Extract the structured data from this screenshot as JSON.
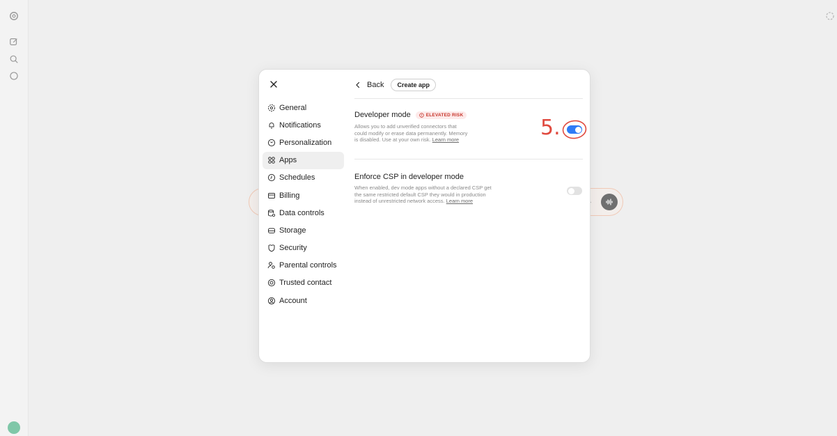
{
  "rail": {
    "icons": [
      "logo-icon",
      "new-chat-icon",
      "search-icon",
      "chat-icon"
    ]
  },
  "modal": {
    "nav": [
      {
        "label": "General",
        "icon": "gear-icon"
      },
      {
        "label": "Notifications",
        "icon": "bell-icon"
      },
      {
        "label": "Personalization",
        "icon": "personalization-icon"
      },
      {
        "label": "Apps",
        "icon": "apps-grid-icon",
        "active": true
      },
      {
        "label": "Schedules",
        "icon": "clock-icon"
      },
      {
        "label": "Billing",
        "icon": "card-icon"
      },
      {
        "label": "Data controls",
        "icon": "database-icon"
      },
      {
        "label": "Storage",
        "icon": "storage-icon"
      },
      {
        "label": "Security",
        "icon": "shield-icon"
      },
      {
        "label": "Parental controls",
        "icon": "parental-icon"
      },
      {
        "label": "Trusted contact",
        "icon": "lifebuoy-icon"
      },
      {
        "label": "Account",
        "icon": "account-icon"
      }
    ],
    "back_label": "Back",
    "create_app_label": "Create app",
    "developer_mode": {
      "title": "Developer mode",
      "badge": "ELEVATED RISK",
      "desc_lines": [
        "Allows you to add unverified connectors that",
        "could modify or erase data permanently. Memory",
        "is disabled. Use at your own risk. "
      ],
      "learn_more": "Learn more",
      "enabled": true
    },
    "enforce_csp": {
      "title": "Enforce CSP in developer mode",
      "desc_lines": [
        "When enabled, dev mode apps without a declared CSP get",
        "the same restricted default CSP they would in production",
        "instead of unrestricted network access. "
      ],
      "learn_more": "Learn more",
      "enabled": false
    }
  },
  "annotation": {
    "number": "5."
  },
  "colors": {
    "accent": "#2f7bf6",
    "risk": "#c7352b",
    "annotation": "#e04a3f"
  }
}
